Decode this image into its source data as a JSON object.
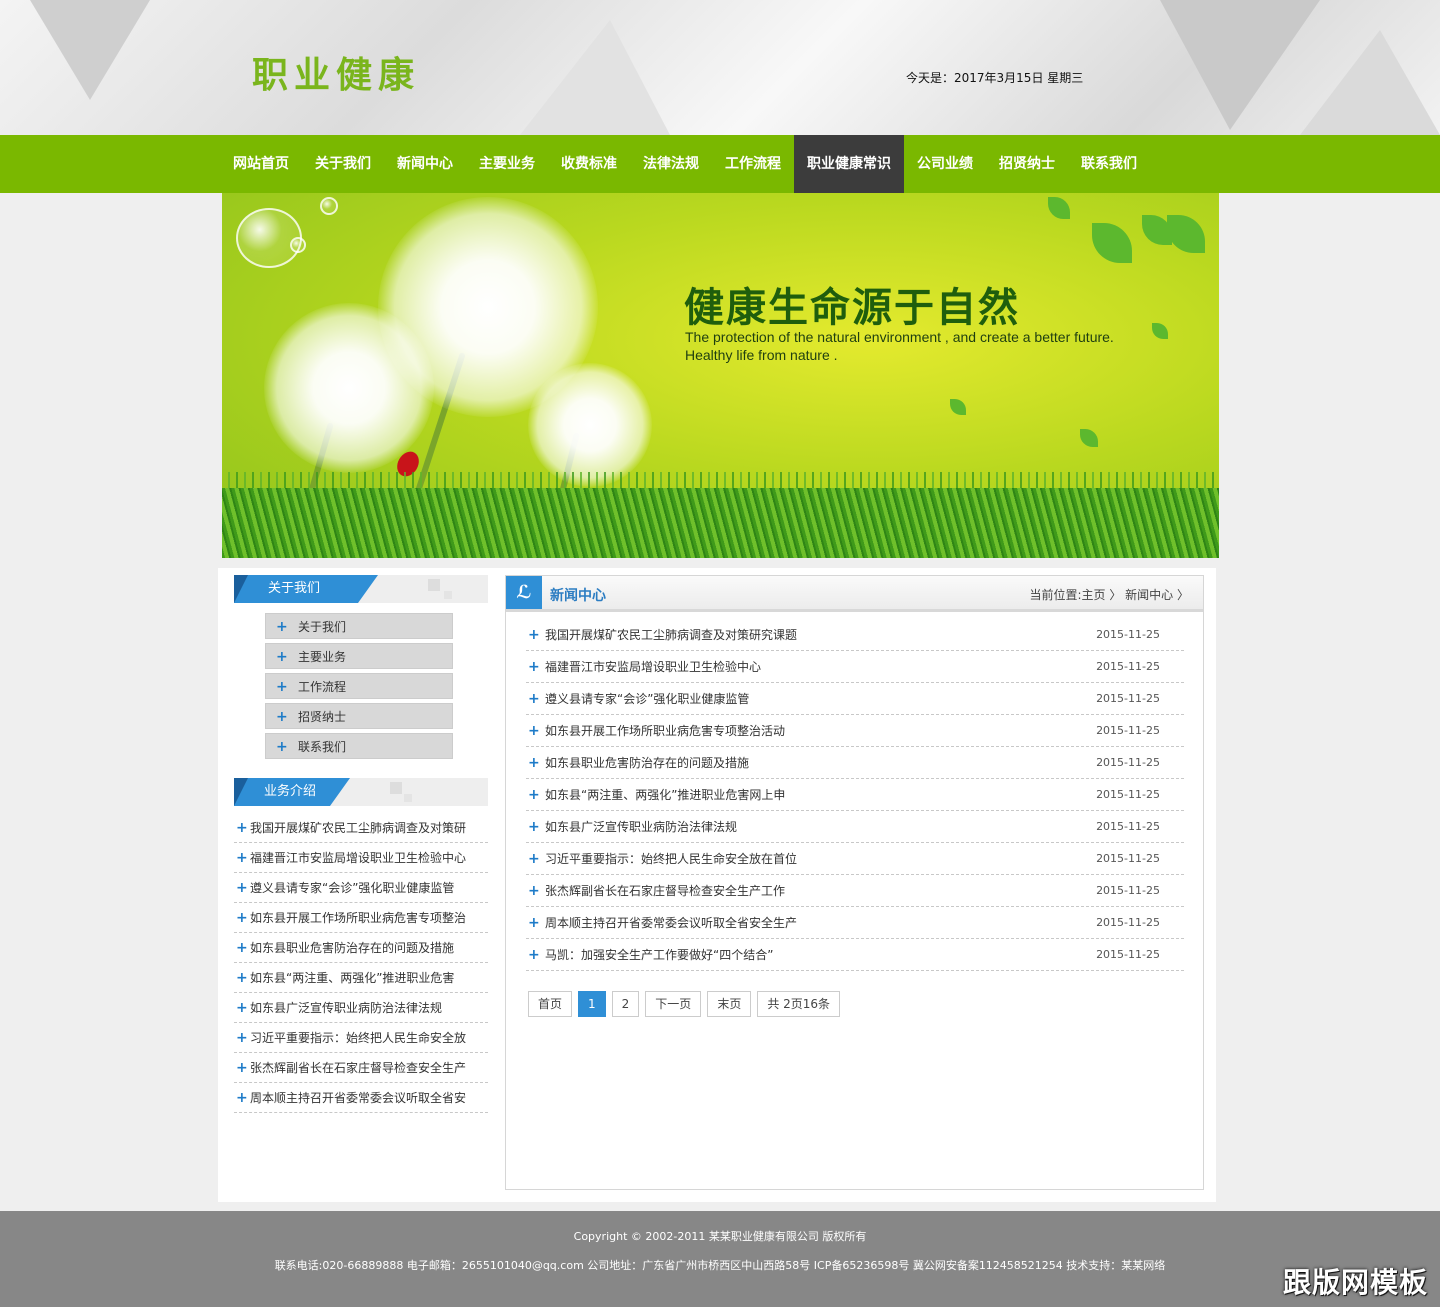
{
  "header": {
    "logo": "职业健康",
    "date": "今天是：2017年3月15日  星期三"
  },
  "nav": {
    "items": [
      "网站首页",
      "关于我们",
      "新闻中心",
      "主要业务",
      "收费标准",
      "法律法规",
      "工作流程",
      "职业健康常识",
      "公司业绩",
      "招贤纳士",
      "联系我们"
    ],
    "active_index": 7
  },
  "banner": {
    "headline": "健康生命源于自然",
    "line1": "The protection of the natural environment , and create a better future.",
    "line2": "Healthy life from nature ."
  },
  "sidebar": {
    "about_title": "关于我们",
    "about_items": [
      "关于我们",
      "主要业务",
      "工作流程",
      "招贤纳士",
      "联系我们"
    ],
    "biz_title": "业务介绍",
    "biz_items": [
      "我国开展煤矿农民工尘肺病调查及对策研",
      "福建晋江市安监局增设职业卫生检验中心",
      "遵义县请专家“会诊”强化职业健康监管",
      "如东县开展工作场所职业病危害专项整治",
      "如东县职业危害防治存在的问题及措施",
      "如东县“两注重、两强化”推进职业危害",
      "如东县广泛宣传职业病防治法律法规",
      "习近平重要指示：始终把人民生命安全放",
      "张杰辉副省长在石家庄督导检查安全生产",
      "周本顺主持召开省委常委会议听取全省安"
    ]
  },
  "main": {
    "icon": "ℒ",
    "title": "新闻中心",
    "breadcrumb": "当前位置:主页 〉 新闻中心 〉",
    "news": [
      {
        "title": "我国开展煤矿农民工尘肺病调查及对策研究课题",
        "date": "2015-11-25"
      },
      {
        "title": "福建晋江市安监局增设职业卫生检验中心",
        "date": "2015-11-25"
      },
      {
        "title": "遵义县请专家“会诊”强化职业健康监管",
        "date": "2015-11-25"
      },
      {
        "title": "如东县开展工作场所职业病危害专项整治活动",
        "date": "2015-11-25"
      },
      {
        "title": "如东县职业危害防治存在的问题及措施",
        "date": "2015-11-25"
      },
      {
        "title": "如东县“两注重、两强化”推进职业危害网上申",
        "date": "2015-11-25"
      },
      {
        "title": "如东县广泛宣传职业病防治法律法规",
        "date": "2015-11-25"
      },
      {
        "title": "习近平重要指示：始终把人民生命安全放在首位",
        "date": "2015-11-25"
      },
      {
        "title": "张杰辉副省长在石家庄督导检查安全生产工作",
        "date": "2015-11-25"
      },
      {
        "title": "周本顺主持召开省委常委会议听取全省安全生产",
        "date": "2015-11-25"
      },
      {
        "title": "马凯：加强安全生产工作要做好“四个结合”",
        "date": "2015-11-25"
      }
    ],
    "pager": {
      "first": "首页",
      "page1": "1",
      "page2": "2",
      "next": "下一页",
      "last": "末页",
      "info": "共 2页16条"
    }
  },
  "footer": {
    "copyright": "Copyright © 2002-2011 某某职业健康有限公司 版权所有",
    "contact": "联系电话:020-66889888 电子邮箱：2655101040@qq.com 公司地址：广东省广州市桥西区中山西路58号 ICP备65236598号 冀公网安备案112458521254 技术支持：某某网络",
    "watermark": "跟版网模板"
  },
  "colors": {
    "brand_green": "#7ab800",
    "nav_active": "#3c3c3c",
    "accent_blue": "#2f8fd6",
    "footer_gray": "#878787"
  }
}
